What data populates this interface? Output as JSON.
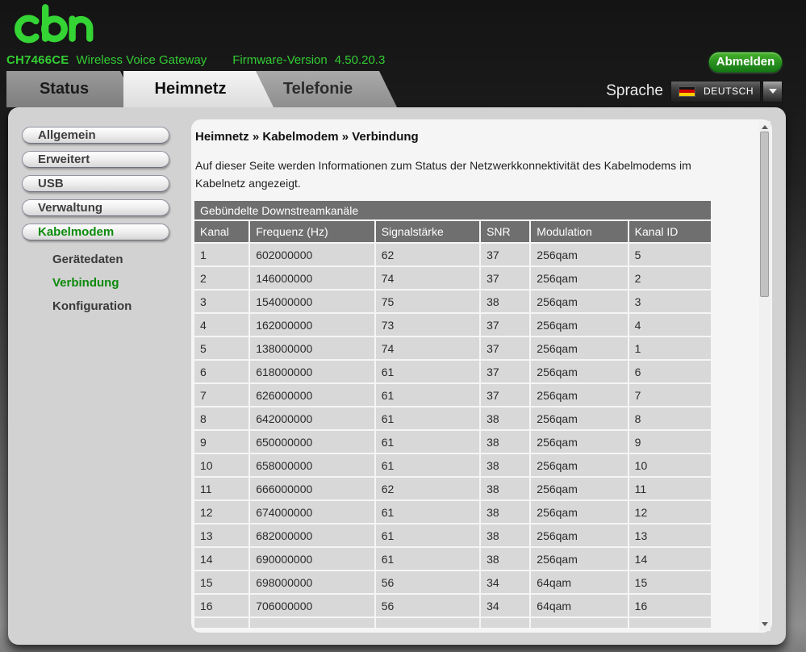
{
  "header": {
    "logo_text": "cbn",
    "model": "CH7466CE",
    "product_name": "Wireless Voice Gateway",
    "firmware_label": "Firmware-Version",
    "firmware_version": "4.50.20.3",
    "logout_button": "Abmelden"
  },
  "tab_bar": {
    "tabs": [
      {
        "label": "Status",
        "active": false
      },
      {
        "label": "Heimnetz",
        "active": true
      },
      {
        "label": "Telefonie",
        "active": false
      }
    ],
    "language": {
      "label": "Sprache",
      "selected": "DEUTSCH",
      "flag": "german-flag"
    }
  },
  "sidebar": {
    "items": [
      {
        "label": "Allgemein",
        "active": false
      },
      {
        "label": "Erweitert",
        "active": false
      },
      {
        "label": "USB",
        "active": false
      },
      {
        "label": "Verwaltung",
        "active": false
      },
      {
        "label": "Kabelmodem",
        "active": true
      }
    ],
    "subitems": [
      {
        "label": "Gerätedaten",
        "active": false
      },
      {
        "label": "Verbindung",
        "active": true
      },
      {
        "label": "Konfiguration",
        "active": false
      }
    ]
  },
  "main": {
    "breadcrumb": "Heimnetz » Kabelmodem » Verbindung",
    "description": "Auf dieser Seite werden Informationen zum Status der Netzwerkkonnektivität des Kabelmodems im Kabelnetz angezeigt.",
    "table": {
      "title": "Gebündelte Downstreamkanäle",
      "columns": [
        "Kanal",
        "Frequenz (Hz)",
        "Signalstärke",
        "SNR",
        "Modulation",
        "Kanal ID"
      ],
      "rows": [
        [
          "1",
          "602000000",
          "62",
          "37",
          "256qam",
          "5"
        ],
        [
          "2",
          "146000000",
          "74",
          "37",
          "256qam",
          "2"
        ],
        [
          "3",
          "154000000",
          "75",
          "38",
          "256qam",
          "3"
        ],
        [
          "4",
          "162000000",
          "73",
          "37",
          "256qam",
          "4"
        ],
        [
          "5",
          "138000000",
          "74",
          "37",
          "256qam",
          "1"
        ],
        [
          "6",
          "618000000",
          "61",
          "37",
          "256qam",
          "6"
        ],
        [
          "7",
          "626000000",
          "61",
          "37",
          "256qam",
          "7"
        ],
        [
          "8",
          "642000000",
          "61",
          "38",
          "256qam",
          "8"
        ],
        [
          "9",
          "650000000",
          "61",
          "38",
          "256qam",
          "9"
        ],
        [
          "10",
          "658000000",
          "61",
          "38",
          "256qam",
          "10"
        ],
        [
          "11",
          "666000000",
          "62",
          "38",
          "256qam",
          "11"
        ],
        [
          "12",
          "674000000",
          "61",
          "38",
          "256qam",
          "12"
        ],
        [
          "13",
          "682000000",
          "61",
          "38",
          "256qam",
          "13"
        ],
        [
          "14",
          "690000000",
          "61",
          "38",
          "256qam",
          "14"
        ],
        [
          "15",
          "698000000",
          "56",
          "34",
          "64qam",
          "15"
        ],
        [
          "16",
          "706000000",
          "56",
          "34",
          "64qam",
          "16"
        ]
      ]
    }
  },
  "colors": {
    "brand_green": "#33cc33",
    "active_nav_green": "#0c8a0c",
    "logout_button_green": "#2b9420",
    "table_header_bg": "#6f6f6f",
    "table_row_bg": "#d8d8d8",
    "container_bg": "#d2d2d2",
    "panel_bg": "#f5f5f5"
  }
}
